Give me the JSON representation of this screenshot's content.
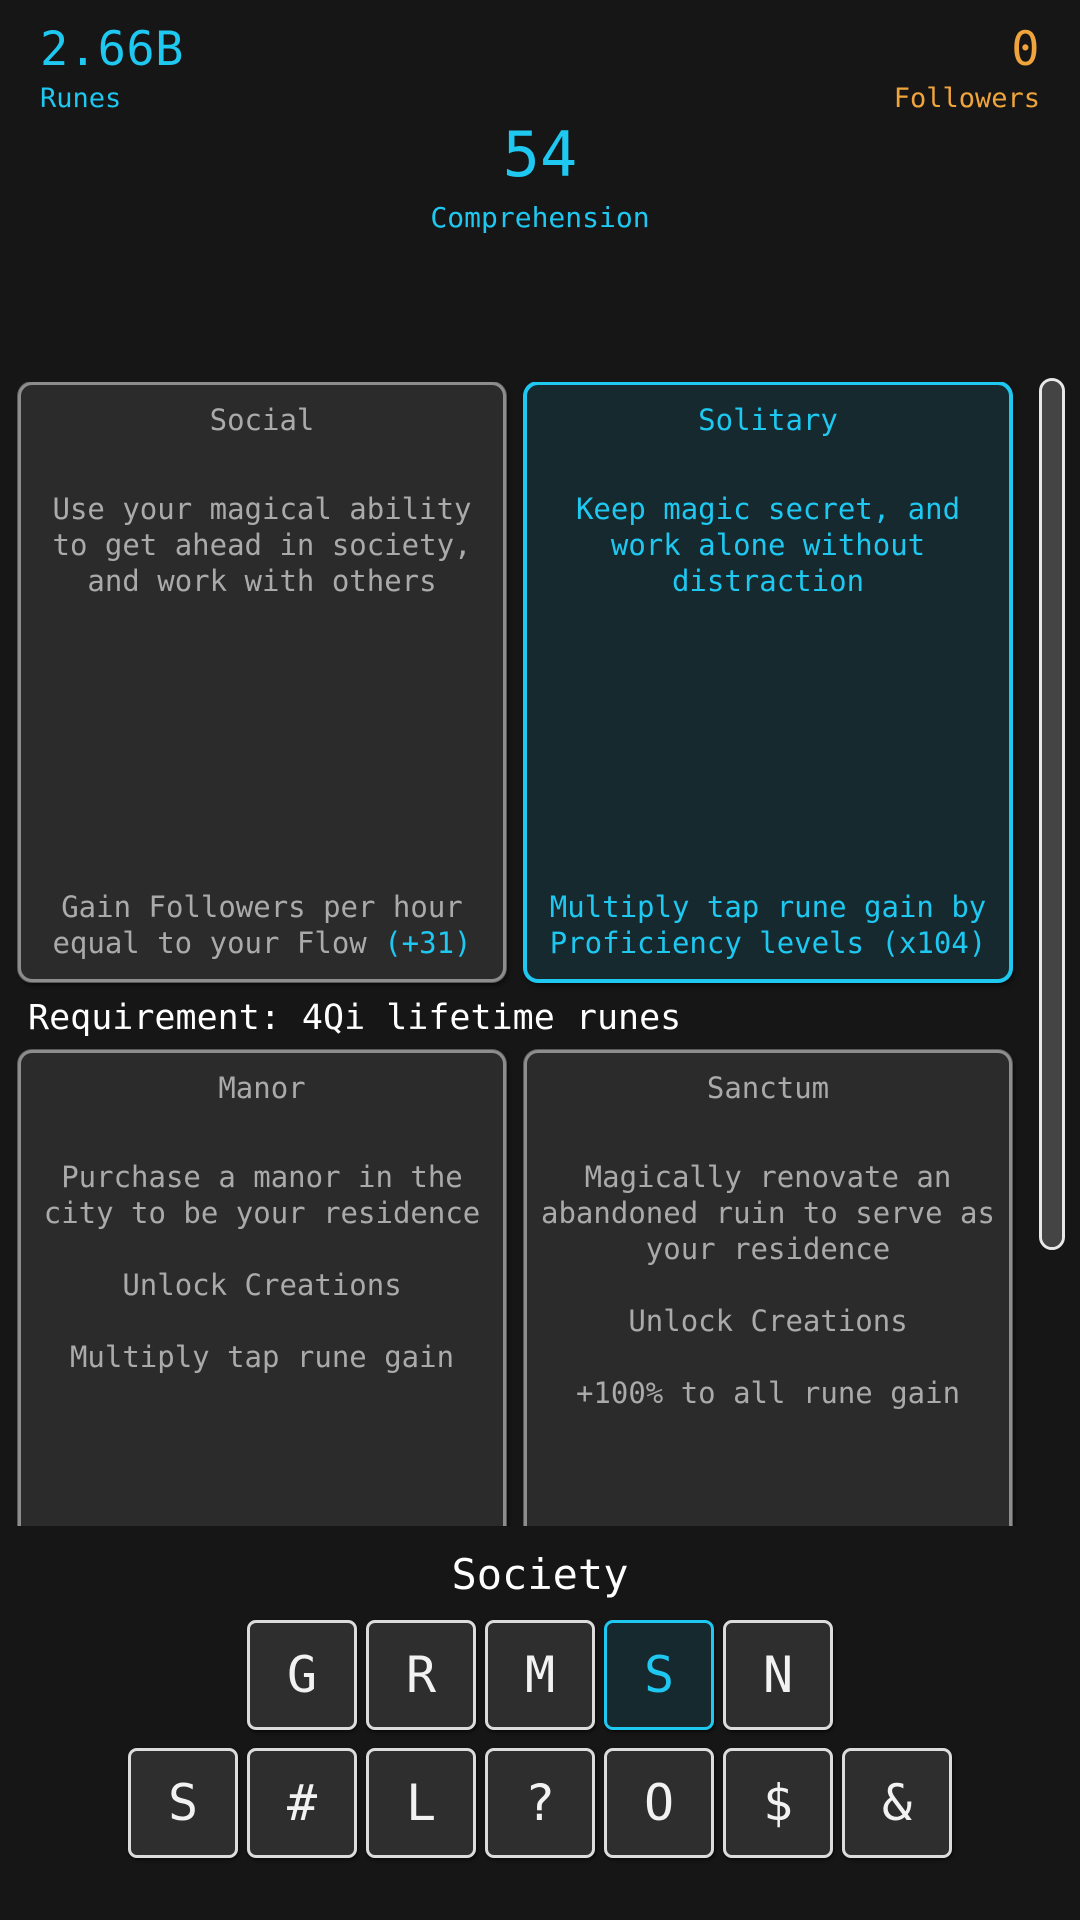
{
  "header": {
    "runes": {
      "value": "2.66B",
      "label": "Runes",
      "color": "#1ec8f0"
    },
    "followers": {
      "value": "0",
      "label": "Followers",
      "color": "#f0a53c"
    },
    "center": {
      "value": "54",
      "label": "Comprehension",
      "color": "#1ec8f0"
    }
  },
  "choices": {
    "row1": [
      {
        "title": "Social",
        "description": "Use your magical ability to get ahead in society, and work with others",
        "effect": "Gain Followers per hour equal to your Flow",
        "effect_value": "(+31)",
        "selected": false
      },
      {
        "title": "Solitary",
        "description": "Keep magic secret, and work alone without distraction",
        "effect": "Multiply tap rune gain by Proficiency levels",
        "effect_value": "(x104)",
        "selected": true
      }
    ],
    "requirement": "Requirement: 4Qi lifetime runes",
    "row2": [
      {
        "title": "Manor",
        "description": "Purchase a manor in the city to be your residence",
        "effect": "Unlock Creations",
        "effect_2": "Multiply tap rune gain",
        "selected": false
      },
      {
        "title": "Sanctum",
        "description": "Magically renovate an abandoned ruin to serve as your residence",
        "effect": "Unlock Creations",
        "effect_2": "+100% to all rune gain",
        "selected": false
      }
    ]
  },
  "footer": {
    "section_label": "Society",
    "keys_row1": [
      {
        "glyph": "G",
        "active": false
      },
      {
        "glyph": "R",
        "active": false
      },
      {
        "glyph": "M",
        "active": false
      },
      {
        "glyph": "S",
        "active": true
      },
      {
        "glyph": "N",
        "active": false
      }
    ],
    "keys_row2": [
      {
        "glyph": "S",
        "active": false
      },
      {
        "glyph": "#",
        "active": false
      },
      {
        "glyph": "L",
        "active": false
      },
      {
        "glyph": "?",
        "active": false
      },
      {
        "glyph": "O",
        "active": false
      },
      {
        "glyph": "$",
        "active": false
      },
      {
        "glyph": "&",
        "active": false
      }
    ]
  }
}
